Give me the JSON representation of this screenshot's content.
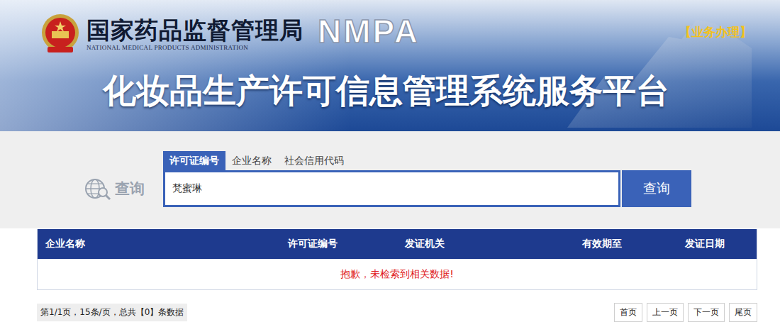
{
  "header": {
    "agency_cn": "国家药品监督管理局",
    "agency_en": "NATIONAL MEDICAL PRODUCTS ADMINISTRATION",
    "abbr": "NMPA",
    "link": "【业务办理】",
    "title": "化妆品生产许可信息管理系统服务平台"
  },
  "search": {
    "label": "查询",
    "tabs": [
      {
        "label": "许可证编号",
        "selected": true
      },
      {
        "label": "企业名称",
        "selected": false
      },
      {
        "label": "社会信用代码",
        "selected": false
      }
    ],
    "value": "梵蜜琳",
    "button": "查询"
  },
  "table": {
    "columns": [
      "企业名称",
      "许可证编号",
      "发证机关",
      "有效期至",
      "发证日期"
    ],
    "rows": [],
    "empty_message": "抱歉，未检索到相关数据!"
  },
  "pagination": {
    "summary": "第1/1页，15条/页，总共【0】条数据",
    "buttons": [
      "首页",
      "上一页",
      "下一页",
      "尾页"
    ]
  }
}
